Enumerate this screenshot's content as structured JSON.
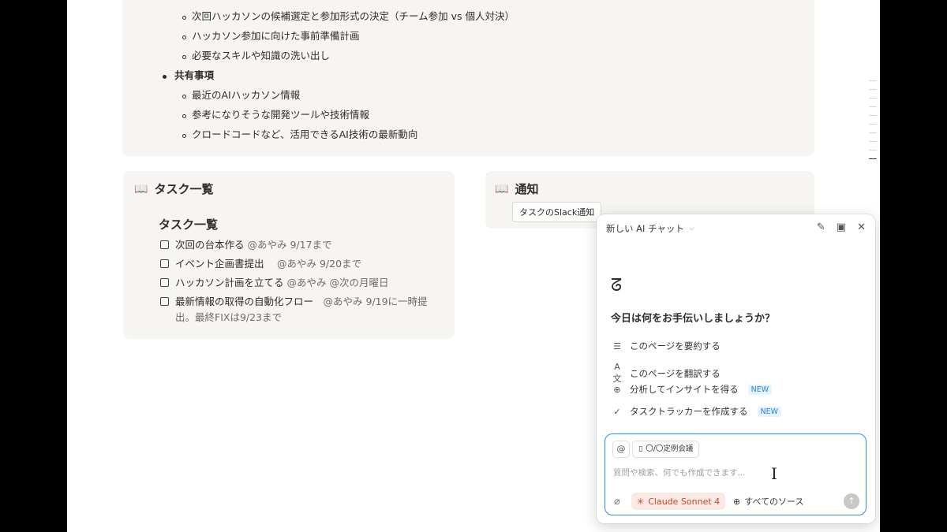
{
  "agenda": {
    "sub_items_1": [
      "次回ハッカソンの候補選定と参加形式の決定（チーム参加 vs 個人対決）",
      "ハッカソン参加に向けた事前準備計画",
      "必要なスキルや知識の洗い出し"
    ],
    "shared_heading": "共有事項",
    "sub_items_2": [
      "最近のAIハッカソン情報",
      "参考になりそうな開発ツールや技術情報",
      "クロードコードなど、活用できるAI技術の最新動向"
    ]
  },
  "task_card": {
    "title": "タスク一覧",
    "subtitle": "タスク一覧",
    "tasks": [
      {
        "text": "次回の台本作る",
        "mention": "@あやみ 9/17まで"
      },
      {
        "text": "イベント企画書提出",
        "mention": "　@あやみ 9/20まで"
      },
      {
        "text": "ハッカソン計画を立てる",
        "mention": "@あやみ @次の月曜日"
      },
      {
        "text": "最新情報の取得の自動化フロー",
        "mention": "　@あやみ 9/19に一時提出。最終FIXは9/23まで"
      }
    ]
  },
  "notify_card": {
    "title": "通知",
    "chip": "タスクのSlack通知"
  },
  "ai_panel": {
    "header_title": "新しい AI チャット",
    "greeting": "今日は何をお手伝いしましょうか？",
    "suggestions": [
      {
        "label": "このページを要約する",
        "icon": "lines-icon",
        "badge": ""
      },
      {
        "label": "このページを翻訳する",
        "icon": "translate-icon",
        "badge": ""
      },
      {
        "label": "分析してインサイトを得る",
        "icon": "zoom-plus-icon",
        "badge": "NEW"
      },
      {
        "label": "タスクトラッカーを作成する",
        "icon": "check-circle-icon",
        "badge": "NEW"
      }
    ],
    "context_chip": "〇/〇定例会議",
    "placeholder": "質問や検索、何でも作成できます...",
    "model": "Claude Sonnet 4",
    "sources": "すべてのソース"
  },
  "colors": {
    "card_bg": "#f6f5f1",
    "accent_blue": "#2d8ef0",
    "model_red": "#c2492b"
  }
}
